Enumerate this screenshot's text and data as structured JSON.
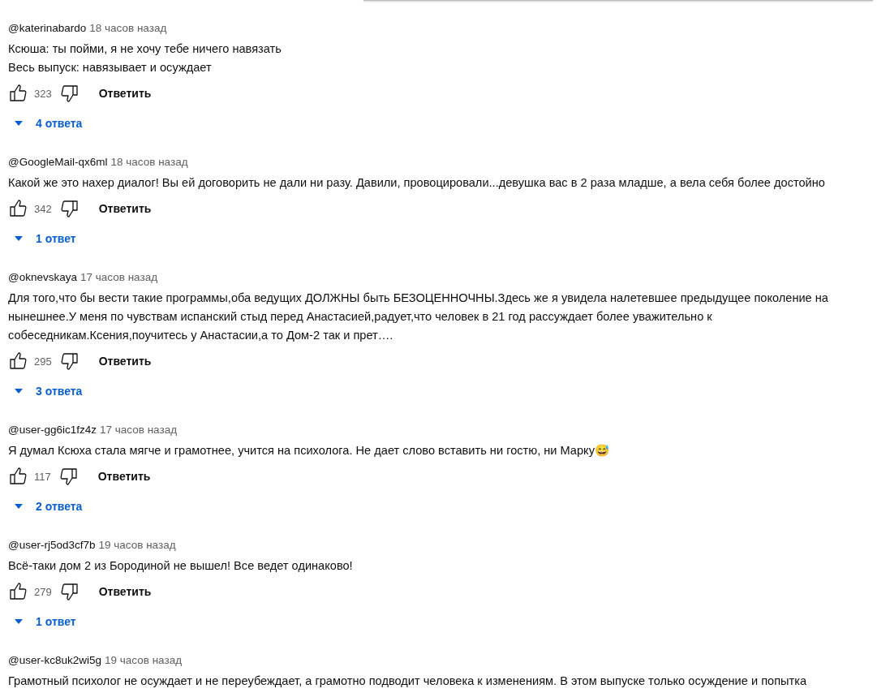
{
  "comments": [
    {
      "author": "@katerinabardo",
      "time": "18 часов назад",
      "lines": [
        "Ксюша: ты пойми, я не хочу тебе ничего навязать",
        "Весь выпуск: навязывает и осуждает"
      ],
      "likes": "323",
      "reply_button": "Ответить",
      "replies": "4 ответа"
    },
    {
      "author": "@GoogleMail-qx6ml",
      "time": "18 часов назад",
      "lines": [
        "Какой же это нахер диалог! Вы ей договорить не дали ни разу. Давили, провоцировали...девушка вас в 2 раза младше, а  вела себя более достойно"
      ],
      "likes": "342",
      "reply_button": "Ответить",
      "replies": "1 ответ"
    },
    {
      "author": "@oknevskaya",
      "time": "17 часов назад",
      "lines": [
        "Для того,что бы вести такие программы,оба ведущих ДОЛЖНЫ быть БЕЗОЦЕННОЧНЫ.Здесь же я увидела налетевшее предыдущее поколение на нынешнее.У меня по чувствам испанский стыд перед Анастасией,радует,что человек в 21 год рассуждает более уважительно к собеседникам.Ксения,поучитесь у Анастасии,а то Дом-2 так и прет…."
      ],
      "likes": "295",
      "reply_button": "Ответить",
      "replies": "3 ответа"
    },
    {
      "author": "@user-gg6ic1fz4z",
      "time": "17 часов назад",
      "lines": [
        "Я думал Ксюха стала мягче и грамотнее, учится на психолога. Не дает слово вставить ни гостю, ни Марку😅"
      ],
      "likes": "117",
      "reply_button": "Ответить",
      "replies": "2 ответа"
    },
    {
      "author": "@user-rj5od3cf7b",
      "time": "19 часов назад",
      "lines": [
        "Всё-таки дом 2 из Бородиной не вышел! Все ведет одинаково!"
      ],
      "likes": "279",
      "reply_button": "Ответить",
      "replies": "1 ответ"
    },
    {
      "author": "@user-kc8uk2wi5g",
      "time": "19 часов назад",
      "lines": [
        "Грамотный психолог не осуждает и не переубеждает, а грамотно подводит человека к изменениям. В этом выпуске только осуждение и попытка"
      ]
    }
  ]
}
